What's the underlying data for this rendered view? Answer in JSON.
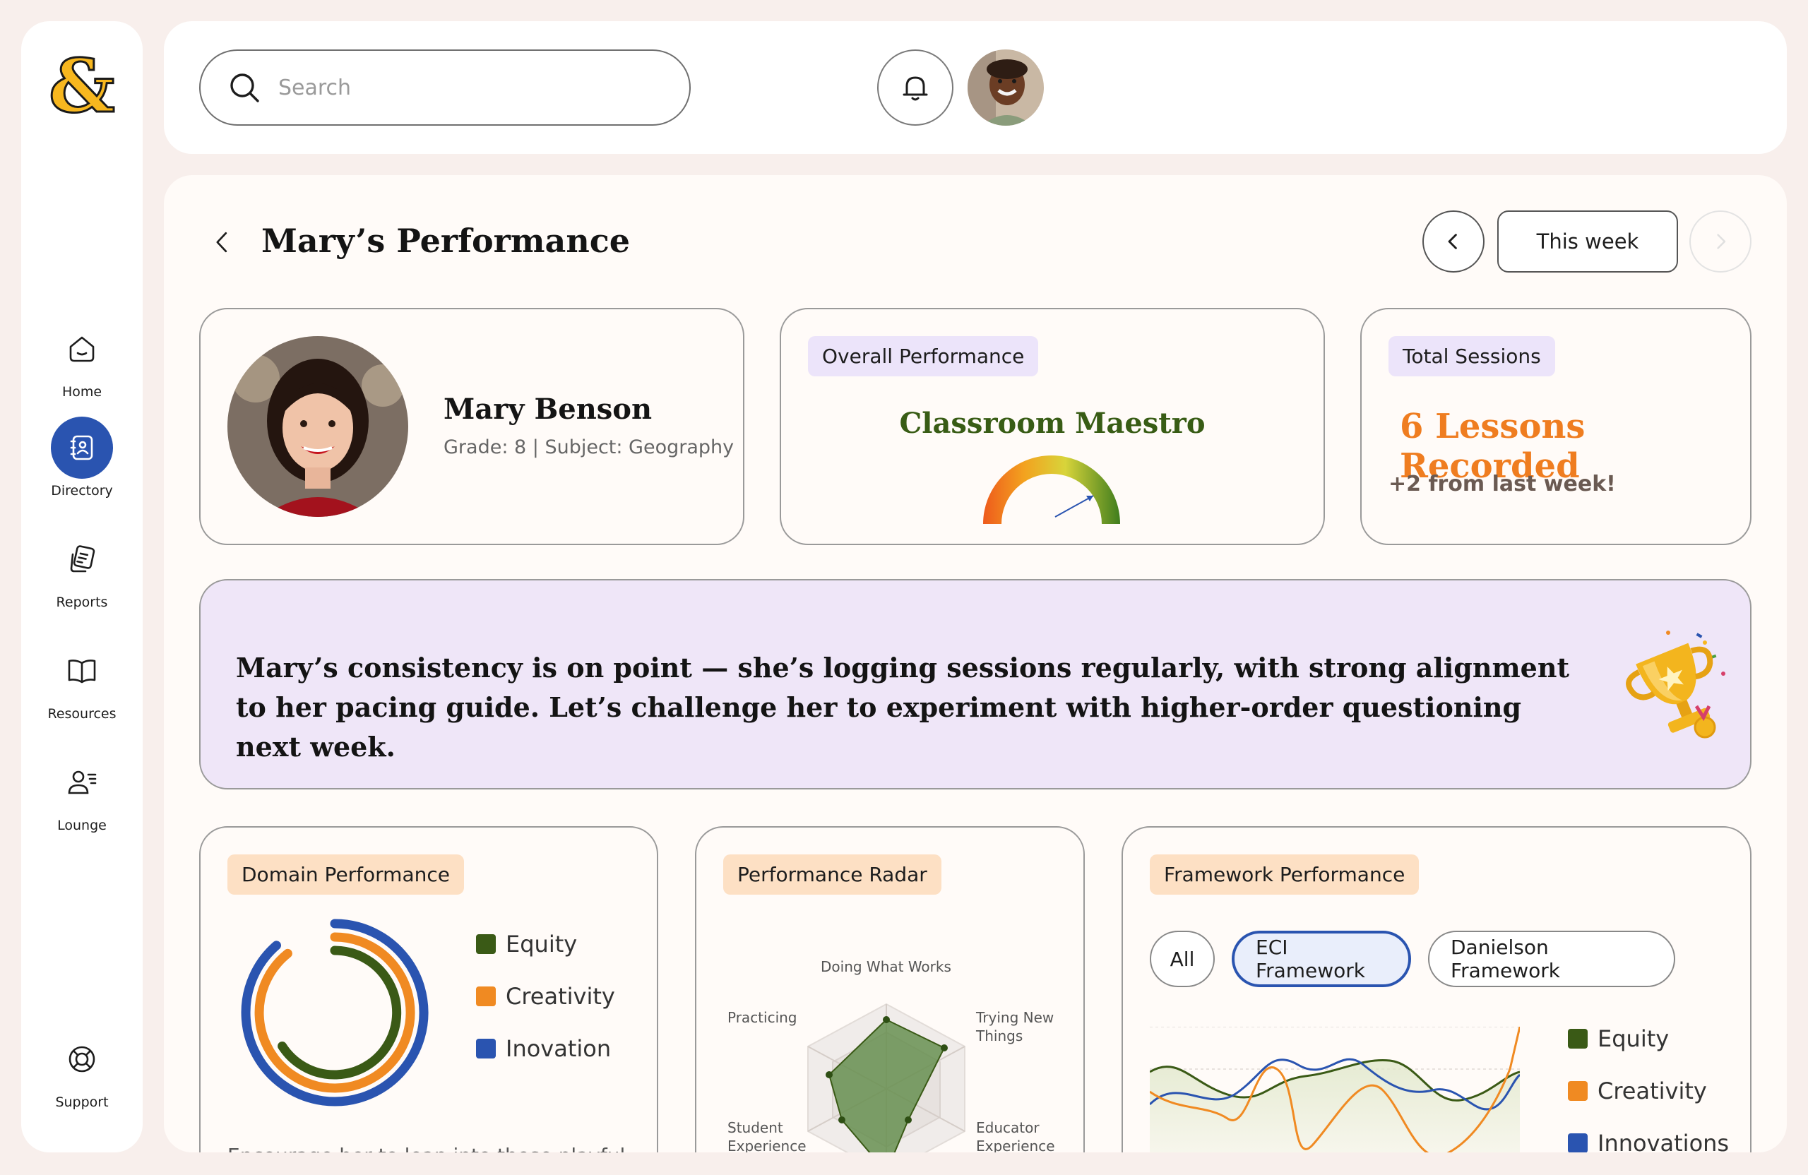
{
  "sidebar": {
    "items": [
      {
        "label": "Home",
        "icon": "home-icon"
      },
      {
        "label": "Directory",
        "icon": "directory-icon"
      },
      {
        "label": "Reports",
        "icon": "reports-icon"
      },
      {
        "label": "Resources",
        "icon": "book-icon"
      },
      {
        "label": "Lounge",
        "icon": "lounge-icon"
      }
    ],
    "support": {
      "label": "Support",
      "icon": "lifebuoy-icon"
    },
    "active_index": 1,
    "accent": "#2a54b0"
  },
  "topbar": {
    "search_placeholder": "Search"
  },
  "page": {
    "title": "Mary’s Performance",
    "week_label": "This week"
  },
  "profile": {
    "name": "Mary Benson",
    "meta": "Grade: 8 | Subject: Geography"
  },
  "overall": {
    "tag": "Overall Performance",
    "title": "Classroom Maestro"
  },
  "sessions": {
    "tag": "Total Sessions",
    "title": "6 Lessons Recorded",
    "subtitle": "+2 from last week!"
  },
  "banner": {
    "text": "Mary’s consistency is on point — she’s logging sessions regularly, with strong alignment to her pacing guide. Let’s challenge her to experiment with higher-order questioning next week."
  },
  "domain": {
    "tag": "Domain Performance",
    "legend": [
      "Equity",
      "Creativity",
      "Inovation"
    ],
    "footer": "Encourage her to lean into those playful"
  },
  "radar": {
    "tag": "Performance Radar",
    "axes": [
      "Doing What Works",
      "Trying New Things",
      "Educator Experience",
      "Student Experience",
      "Practicing"
    ]
  },
  "framework": {
    "tag": "Framework Performance",
    "filters": [
      "All",
      "ECI Framework",
      "Danielson Framework"
    ],
    "active_filter": "ECI Framework",
    "legend": [
      "Equity",
      "Creativity",
      "Innovations"
    ]
  },
  "colors": {
    "equity": "#3a5a16",
    "creativity": "#f08a22",
    "innovation": "#2a54b0",
    "maestro": "#385c15",
    "lessons": "#ef7d20"
  }
}
